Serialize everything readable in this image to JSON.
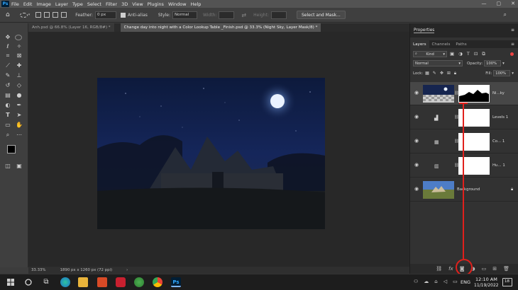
{
  "menu": {
    "logo": "Ps",
    "items": [
      "File",
      "Edit",
      "Image",
      "Layer",
      "Type",
      "Select",
      "Filter",
      "3D",
      "View",
      "Plugins",
      "Window",
      "Help"
    ],
    "window_controls": [
      "—",
      "▢",
      "✕"
    ]
  },
  "options": {
    "feather_label": "Feather:",
    "feather_value": "0 px",
    "antialias_label": "Anti-alias",
    "style_label": "Style:",
    "style_value": "Normal",
    "width_label": "Width:",
    "height_label": "Height:",
    "select_mask_label": "Select and Mask..."
  },
  "tabs": [
    {
      "label": "Anh.psd @ 66.8% (Layer 16, RGB/8#) *",
      "active": false
    },
    {
      "label": "Change day into night with a Color Lookup Table _Finish.psd @ 33.3% (Night Sky, Layer Mask/8) *",
      "active": true
    }
  ],
  "status": {
    "zoom": "33.33%",
    "doc_size": "1890 px x 1260 px (72 ppi)"
  },
  "properties_panel": {
    "title": "Properties"
  },
  "layers_panel": {
    "tabs": [
      "Layers",
      "Channels",
      "Paths"
    ],
    "kind_label": "Kind",
    "blend_mode": "Normal",
    "opacity_label": "Opacity:",
    "opacity_value": "100%",
    "lock_label": "Lock:",
    "fill_label": "Fill:",
    "fill_value": "100%",
    "layers": [
      {
        "name": "Ni...ky",
        "type": "image-mask",
        "selected": true
      },
      {
        "name": "Levels 1",
        "type": "adjustment",
        "icon": "levels-icon"
      },
      {
        "name": "Co... 1",
        "type": "adjustment",
        "icon": "color-lookup-icon"
      },
      {
        "name": "Hu... 1",
        "type": "adjustment",
        "icon": "hue-saturation-icon"
      },
      {
        "name": "Background",
        "type": "image"
      }
    ]
  },
  "taskbar": {
    "lang": "ENG",
    "time": "12:10 AM",
    "date": "11/19/2022",
    "notification_count": "18"
  },
  "colors": {
    "annotation": "#e0201c",
    "ps_blue": "#31a8ff"
  }
}
